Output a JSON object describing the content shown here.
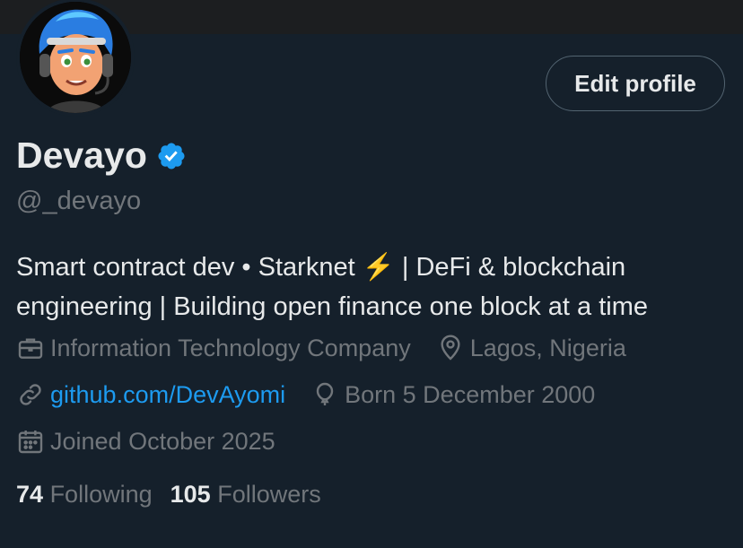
{
  "profile": {
    "display_name": "Devayo",
    "handle": "@_devayo",
    "bio_line1": "Smart contract dev • Starknet ⚡️ | DeFi & blockchain",
    "bio_line2": "engineering | Building open finance one block at a time",
    "category": "Information Technology Company",
    "location": "Lagos, Nigeria",
    "website": "github.com/DevAyomi",
    "birthday": "Born 5 December 2000",
    "joined": "Joined October 2025",
    "following_count": "74",
    "following_label": "Following",
    "followers_count": "105",
    "followers_label": "Followers"
  },
  "actions": {
    "edit_profile_label": "Edit profile"
  },
  "icons": {
    "verified": "verified-badge-icon",
    "category": "briefcase-icon",
    "location": "location-pin-icon",
    "website": "link-icon",
    "birthday": "balloon-icon",
    "joined": "calendar-icon"
  },
  "colors": {
    "background": "#15202b",
    "accent": "#1d9bf0",
    "text_primary": "#e7e9ea",
    "text_secondary": "#71767b"
  }
}
